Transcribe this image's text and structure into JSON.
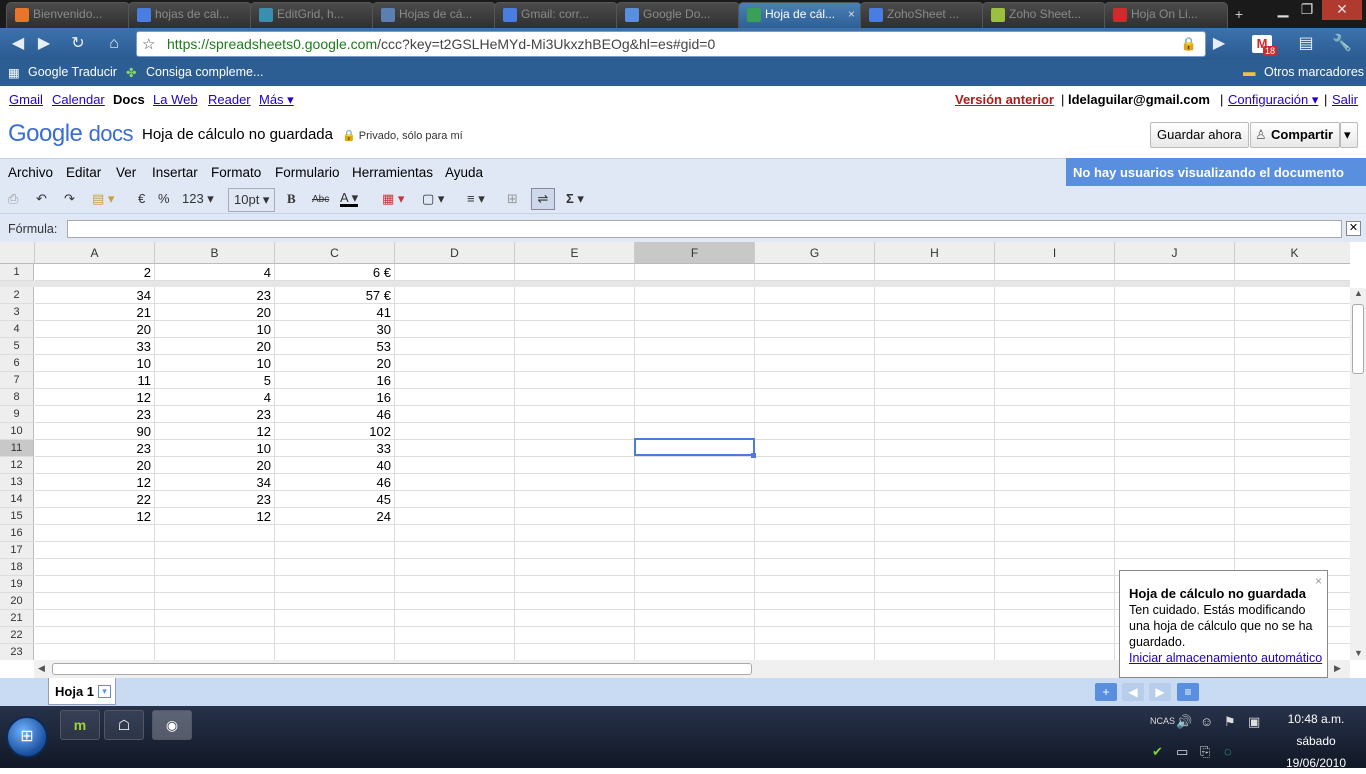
{
  "browser": {
    "tabs": [
      {
        "label": "Bienvenido...",
        "color": "#e8752a"
      },
      {
        "label": "hojas de cal...",
        "color": "#4a7de0"
      },
      {
        "label": "EditGrid, h...",
        "color": "#3a8fb0"
      },
      {
        "label": "Hojas de cá...",
        "color": "#5a7fb0"
      },
      {
        "label": "Gmail: corr...",
        "color": "#4a7de0"
      },
      {
        "label": "Google Do...",
        "color": "#5a8fe0"
      },
      {
        "label": "Hoja de cál...",
        "color": "#3aa055",
        "active": true
      },
      {
        "label": "ZohoSheet ...",
        "color": "#4a7de0"
      },
      {
        "label": "Zoho Sheet...",
        "color": "#9bc040"
      },
      {
        "label": "Hoja On Li...",
        "color": "#d02b2b"
      }
    ],
    "tab_close": "×",
    "new_tab": "+",
    "url_host": "https://spreadsheets0.google.com",
    "url_path": "/ccc?key=t2GSLHeMYd-Mi3UkxzhBEOg&hl=es#gid=0",
    "gmail_count": "18",
    "bookmarks": [
      "Google Traducir",
      "Consiga compleme..."
    ],
    "other_bookmarks": "Otros marcadores"
  },
  "gbar": {
    "left": [
      "Gmail",
      "Calendar",
      "Docs",
      "La Web",
      "Reader",
      "Más ▾"
    ],
    "old_version": "Versión anterior",
    "email": "ldelaguilar@gmail.com",
    "settings": "Configuración ▾",
    "logout": "Salir"
  },
  "header": {
    "logo_google": "Google",
    "logo_docs": "docs",
    "doc_title": "Hoja de cálculo no guardada",
    "privacy": "Privado, sólo para mí",
    "save_now": "Guardar ahora",
    "share": "Compartir"
  },
  "menu": [
    "Archivo",
    "Editar",
    "Ver",
    "Insertar",
    "Formato",
    "Formulario",
    "Herramientas",
    "Ayuda"
  ],
  "viewers": "No hay usuarios visualizando el documento",
  "toolbar": {
    "euro": "€",
    "percent": "%",
    "numfmt": "123 ▾",
    "fontsize": "10pt ▾",
    "bold": "B",
    "strike": "Abc",
    "sigma": "Σ ▾"
  },
  "formula_label": "Fórmula:",
  "formula_close": "✕",
  "columns": [
    "A",
    "B",
    "C",
    "D",
    "E",
    "F",
    "G",
    "H",
    "I",
    "J",
    "K"
  ],
  "selected": {
    "column": "F",
    "row": "11"
  },
  "rows": [
    {
      "n": "1",
      "a": "2",
      "b": "4",
      "c": "6 €"
    },
    {
      "n": "2",
      "a": "34",
      "b": "23",
      "c": "57 €"
    },
    {
      "n": "3",
      "a": "21",
      "b": "20",
      "c": "41"
    },
    {
      "n": "4",
      "a": "20",
      "b": "10",
      "c": "30"
    },
    {
      "n": "5",
      "a": "33",
      "b": "20",
      "c": "53"
    },
    {
      "n": "6",
      "a": "10",
      "b": "10",
      "c": "20"
    },
    {
      "n": "7",
      "a": "11",
      "b": "5",
      "c": "16"
    },
    {
      "n": "8",
      "a": "12",
      "b": "4",
      "c": "16"
    },
    {
      "n": "9",
      "a": "23",
      "b": "23",
      "c": "46"
    },
    {
      "n": "10",
      "a": "90",
      "b": "12",
      "c": "102"
    },
    {
      "n": "11",
      "a": "23",
      "b": "10",
      "c": "33"
    },
    {
      "n": "12",
      "a": "20",
      "b": "20",
      "c": "40"
    },
    {
      "n": "13",
      "a": "12",
      "b": "34",
      "c": "46"
    },
    {
      "n": "14",
      "a": "22",
      "b": "23",
      "c": "45"
    },
    {
      "n": "15",
      "a": "12",
      "b": "12",
      "c": "24"
    },
    {
      "n": "16",
      "a": "",
      "b": "",
      "c": ""
    },
    {
      "n": "17",
      "a": "",
      "b": "",
      "c": ""
    },
    {
      "n": "18",
      "a": "",
      "b": "",
      "c": ""
    },
    {
      "n": "19",
      "a": "",
      "b": "",
      "c": ""
    },
    {
      "n": "20",
      "a": "",
      "b": "",
      "c": ""
    },
    {
      "n": "21",
      "a": "",
      "b": "",
      "c": ""
    },
    {
      "n": "22",
      "a": "",
      "b": "",
      "c": ""
    },
    {
      "n": "23",
      "a": "",
      "b": "",
      "c": ""
    }
  ],
  "sheet_tab": "Hoja 1",
  "notice": {
    "title": "Hoja de cálculo no guardada",
    "body": "Ten cuidado. Estás modificando una hoja de cálculo que no se ha guardado.",
    "link": "Iniciar almacenamiento automático",
    "close": "×"
  },
  "taskbar": {
    "time": "10:48 a.m.",
    "day": "sábado",
    "date": "19/06/2010"
  }
}
